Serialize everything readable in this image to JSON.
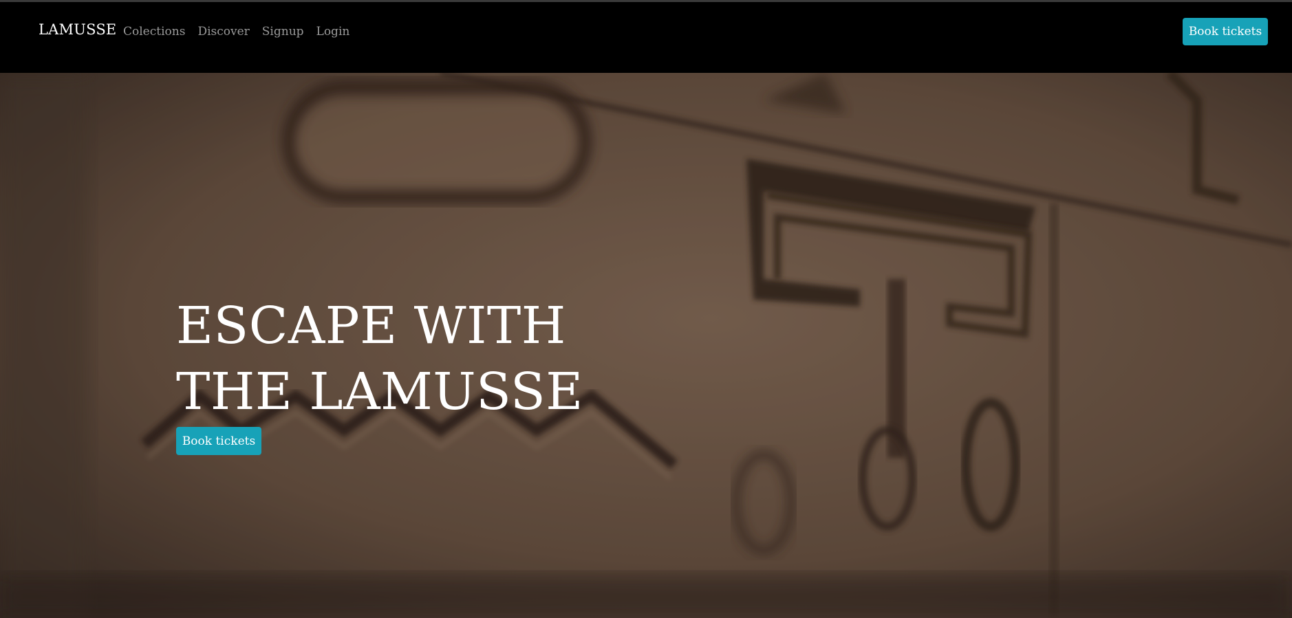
{
  "navbar": {
    "brand": "LAMUSSE",
    "links": [
      "Colections",
      "Discover",
      "Signup",
      "Login"
    ],
    "cta_label": "Book tickets"
  },
  "hero": {
    "title": "ESCAPE WITH THE LAMUSSE",
    "cta_label": "Book tickets",
    "background_image": "blurred carved hieroglyph stone relief"
  },
  "colors": {
    "navbar_bg": "#000000",
    "accent": "#17a2b8",
    "nav_link": "#9a9a9a",
    "stone": "#7a604e"
  }
}
